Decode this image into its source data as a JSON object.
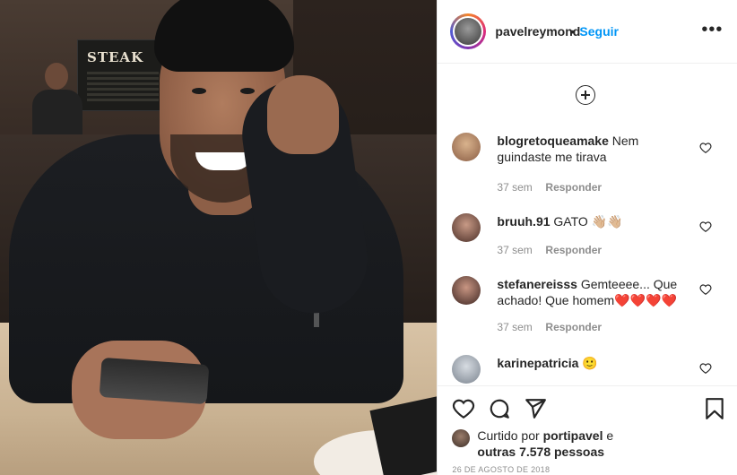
{
  "post": {
    "photo_sign_text": "STEAK",
    "author": {
      "username": "pavelreymond",
      "separator": "•",
      "follow_label": "Seguir",
      "more_label": "•••"
    }
  },
  "comments": [
    {
      "username": "blogretoqueamake",
      "text": "Nem guindaste me tirava",
      "time": "37 sem",
      "reply": "Responder",
      "avatar_color": "#c9a07d"
    },
    {
      "username": "bruuh.91",
      "text": "GATO 👋🏼👋🏼",
      "time": "37 sem",
      "reply": "Responder",
      "avatar_color": "#7a4d3f"
    },
    {
      "username": "stefanereisss",
      "text": "Gemteeee... Que achado! Que homem❤️❤️❤️❤️",
      "time": "37 sem",
      "reply": "Responder",
      "avatar_color": "#5a3a34"
    },
    {
      "username": "karinepatricia",
      "text": "🙂",
      "time": "",
      "reply": "",
      "avatar_color": "#b0b7c0"
    }
  ],
  "likes": {
    "prefix": "Curtido por ",
    "first_user": "portipavel",
    "conjunction": " e",
    "others": "outras 7.578 pessoas"
  },
  "date": "26 DE AGOSTO DE 2018",
  "colors": {
    "link": "#0095f6",
    "text": "#262626",
    "muted": "#8e8e8e"
  },
  "icons": [
    "add-circle-icon",
    "heart-icon",
    "comment-icon",
    "share-icon",
    "bookmark-icon",
    "more-icon"
  ]
}
